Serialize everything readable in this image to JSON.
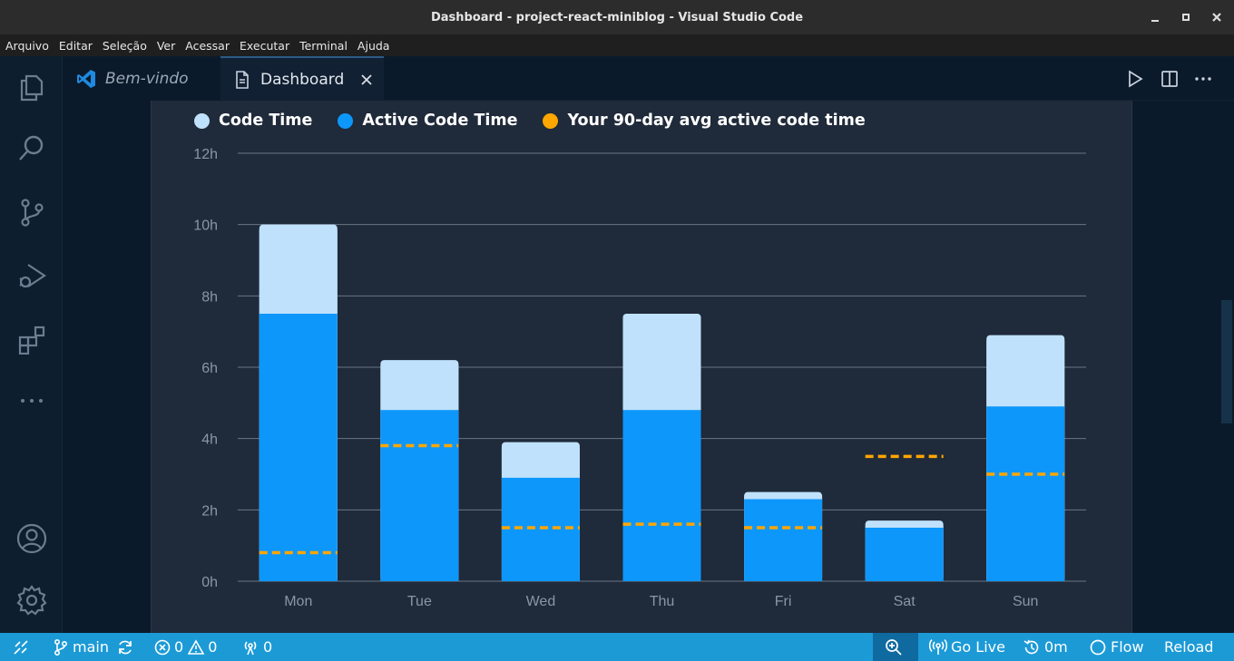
{
  "window": {
    "title": "Dashboard - project-react-miniblog - Visual Studio Code"
  },
  "menu": [
    "Arquivo",
    "Editar",
    "Seleção",
    "Ver",
    "Acessar",
    "Executar",
    "Terminal",
    "Ajuda"
  ],
  "tabs": [
    {
      "label": "Bem-vindo",
      "icon": "vscode-logo-icon"
    },
    {
      "label": "Dashboard",
      "icon": "file-icon",
      "active": true
    }
  ],
  "activity": [
    "explorer-icon",
    "search-icon",
    "source-control-icon",
    "run-debug-icon",
    "extensions-icon",
    "more-icon",
    "account-icon",
    "settings-gear-icon"
  ],
  "legend": [
    {
      "label": "Code Time",
      "color": "#bfe1fb"
    },
    {
      "label": "Active Code Time",
      "color": "#0d97fb"
    },
    {
      "label": "Your 90-day avg active code time",
      "color": "#ffa600"
    }
  ],
  "chart_data": {
    "type": "bar",
    "stacked": true,
    "categories": [
      "Mon",
      "Tue",
      "Wed",
      "Thu",
      "Fri",
      "Sat",
      "Sun"
    ],
    "series": [
      {
        "name": "Code Time",
        "values": [
          10.0,
          6.2,
          3.9,
          7.5,
          2.5,
          1.7,
          6.9
        ],
        "color": "#bfe1fb"
      },
      {
        "name": "Active Code Time",
        "values": [
          7.5,
          4.8,
          2.9,
          4.8,
          2.3,
          1.5,
          4.9
        ],
        "color": "#0d97fb"
      },
      {
        "name": "Your 90-day avg active code time",
        "values": [
          0.8,
          3.8,
          1.5,
          1.6,
          1.5,
          3.5,
          3.0
        ],
        "color": "#ffa600",
        "style": "dashed"
      }
    ],
    "yticks": [
      "0h",
      "2h",
      "4h",
      "6h",
      "8h",
      "10h",
      "12h"
    ],
    "ylim": [
      0,
      12
    ],
    "grid": true,
    "legend_position": "top-left"
  },
  "status": {
    "branch": "main",
    "errors": "0",
    "warnings": "0",
    "ports": "0",
    "golive": "Go Live",
    "time": "0m",
    "flow": "Flow",
    "reload": "Reload"
  }
}
